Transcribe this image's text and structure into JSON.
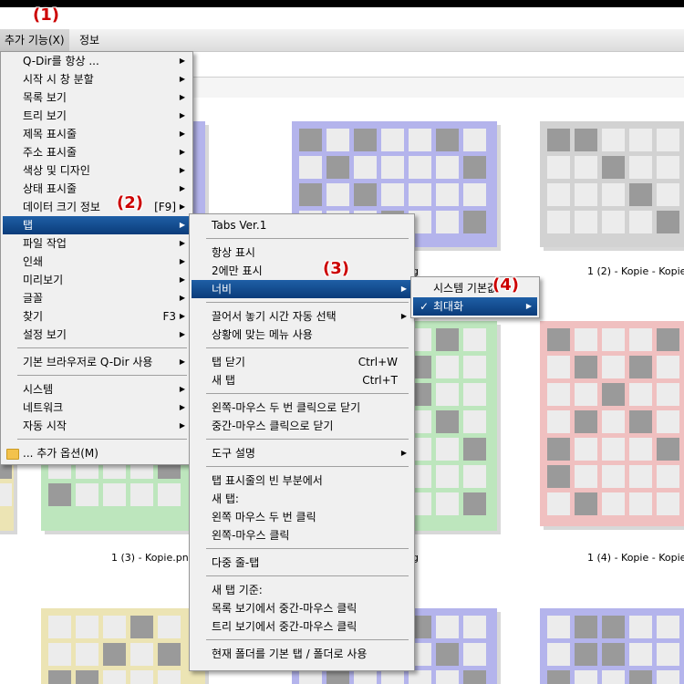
{
  "menubar": {
    "extras": "추가 기능(X)",
    "info": "정보"
  },
  "callouts": [
    "(1)",
    "(2)",
    "(3)",
    "(4)"
  ],
  "main_menu": [
    {
      "label": "Q-Dir를 항상 ...",
      "shortcut": "",
      "submenu": true
    },
    {
      "label": "시작 시 창 분할",
      "shortcut": "",
      "submenu": true
    },
    {
      "label": "목록 보기",
      "shortcut": "",
      "submenu": true
    },
    {
      "label": "트리 보기",
      "shortcut": "",
      "submenu": true
    },
    {
      "label": "제목 표시줄",
      "shortcut": "",
      "submenu": true
    },
    {
      "label": "주소 표시줄",
      "shortcut": "",
      "submenu": true
    },
    {
      "label": "색상 및 디자인",
      "shortcut": "",
      "submenu": true
    },
    {
      "label": "상태 표시줄",
      "shortcut": "",
      "submenu": true
    },
    {
      "label": "데이터 크기 정보",
      "shortcut": "[F9]",
      "submenu": true
    },
    {
      "label": "탭",
      "shortcut": "",
      "submenu": true,
      "highlighted": true
    },
    {
      "label": "파일 작업",
      "shortcut": "",
      "submenu": true
    },
    {
      "label": "인쇄",
      "shortcut": "",
      "submenu": true
    },
    {
      "label": "미리보기",
      "shortcut": "",
      "submenu": true
    },
    {
      "label": "글꼴",
      "shortcut": "",
      "submenu": true
    },
    {
      "label": "찾기",
      "shortcut": "F3",
      "submenu": true
    },
    {
      "label": "설정 보기",
      "shortcut": "",
      "submenu": true
    },
    {
      "sep": true
    },
    {
      "label": "기본 브라우저로 Q-Dir 사용",
      "shortcut": "",
      "submenu": true
    },
    {
      "sep": true
    },
    {
      "label": "시스템",
      "shortcut": "",
      "submenu": true
    },
    {
      "label": "네트워크",
      "shortcut": "",
      "submenu": true
    },
    {
      "label": "자동 시작",
      "shortcut": "",
      "submenu": true
    },
    {
      "sep": true
    },
    {
      "label": "... 추가 옵션(M)",
      "shortcut": "",
      "submenu": false,
      "icon": "folder-icon"
    }
  ],
  "tab_menu": [
    {
      "label": "Tabs Ver.1",
      "shortcut": "",
      "submenu": false
    },
    {
      "sep": true
    },
    {
      "label": "항상 표시",
      "shortcut": "",
      "submenu": false
    },
    {
      "label": "2에만 표시",
      "shortcut": "",
      "submenu": false
    },
    {
      "label": "너비",
      "shortcut": "",
      "submenu": true,
      "highlighted": true
    },
    {
      "sep": true
    },
    {
      "label": "끌어서 놓기 시간 자동 선택",
      "shortcut": "",
      "submenu": true
    },
    {
      "label": "상황에 맞는 메뉴 사용",
      "shortcut": "",
      "submenu": false
    },
    {
      "sep": true
    },
    {
      "label": "탭 닫기",
      "shortcut": "Ctrl+W",
      "submenu": false
    },
    {
      "label": "새 탭",
      "shortcut": "Ctrl+T",
      "submenu": false
    },
    {
      "sep": true
    },
    {
      "label": "왼쪽-마우스 두 번 클릭으로 닫기",
      "shortcut": "",
      "submenu": false
    },
    {
      "label": "중간-마우스 클릭으로 닫기",
      "shortcut": "",
      "submenu": false
    },
    {
      "sep": true
    },
    {
      "label": "도구 설명",
      "shortcut": "",
      "submenu": true
    },
    {
      "sep": true
    },
    {
      "label": "탭 표시줄의 빈 부분에서",
      "shortcut": "",
      "submenu": false
    },
    {
      "label": "새 탭:",
      "shortcut": "",
      "submenu": false
    },
    {
      "label": "왼쪽 마우스 두 번 클릭",
      "shortcut": "",
      "submenu": false
    },
    {
      "label": "왼쪽-마우스 클릭",
      "shortcut": "",
      "submenu": false
    },
    {
      "sep": true
    },
    {
      "label": "다중 줄-탭",
      "shortcut": "",
      "submenu": false
    },
    {
      "sep": true
    },
    {
      "label": "새 탭 기준:",
      "shortcut": "",
      "submenu": false
    },
    {
      "label": "목록 보기에서 중간-마우스 클릭",
      "shortcut": "",
      "submenu": false
    },
    {
      "label": "트리 보기에서 중간-마우스 클릭",
      "shortcut": "",
      "submenu": false
    },
    {
      "sep": true
    },
    {
      "label": "현재 폴더를 기본 탭 / 폴더로 사용",
      "shortcut": "",
      "submenu": false
    }
  ],
  "width_menu": [
    {
      "label": "시스템 기본값",
      "checked": false,
      "submenu": false
    },
    {
      "label": "최대화",
      "checked": true,
      "submenu": true,
      "highlighted": true
    }
  ],
  "thumbnails": [
    {
      "caption": "",
      "color": "#b4b4ec"
    },
    {
      "caption": "",
      "color": "#b4b4ec"
    },
    {
      "caption": "1 (2) - Kopie - Kopie.",
      "color": "#d2d2d2"
    },
    {
      "caption": "",
      "color": "#bde6bd"
    },
    {
      "caption": "1 (3) - Kopie.png",
      "color": "#bde6bd"
    },
    {
      "caption": "g",
      "color": "#bde6bd"
    },
    {
      "caption": "1 (4) - Kopie - Kopie.",
      "color": "#f0c0c0"
    },
    {
      "caption": "",
      "color": "#ece4b4"
    },
    {
      "caption": "",
      "color": "#b4b4ec"
    },
    {
      "caption": "",
      "color": "#ece4b4"
    },
    {
      "caption": "g",
      "color": "#b4b4ec"
    }
  ],
  "colors": {
    "highlight": "#0b3c7a",
    "callout": "#cc0000"
  }
}
